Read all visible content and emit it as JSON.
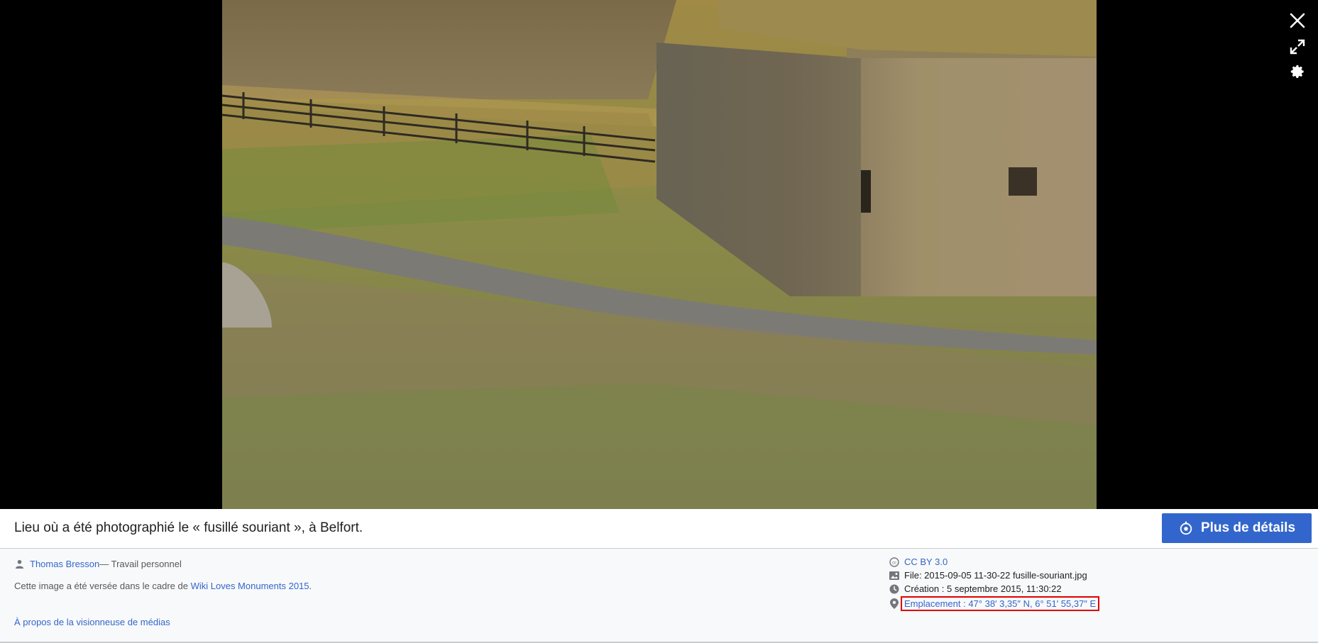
{
  "viewer": {
    "controls": {
      "close": "close-icon",
      "fullscreen": "fullscreen-icon",
      "settings": "gear-icon"
    }
  },
  "caption": {
    "title": "Lieu où a été photographié le « fusillé souriant », à Belfort.",
    "more_details_label": "Plus de détails"
  },
  "attribution": {
    "author": "Thomas Bresson",
    "author_suffix": " — Travail personnel",
    "contest_prefix": "Cette image a été versée dans le cadre de ",
    "contest_link": "Wiki Loves Monuments 2015",
    "contest_suffix": "."
  },
  "metadata": {
    "license": "CC BY 3.0",
    "file": "File: 2015-09-05 11-30-22 fusille-souriant.jpg",
    "creation": "Création : 5 septembre 2015, 11:30:22",
    "location": "Emplacement : 47° 38′ 3,35″ N, 6° 51′ 55,37″ E"
  },
  "footer": {
    "about_link": "À propos de la visionneuse de médias"
  },
  "colors": {
    "accent": "#3366cc",
    "highlight": "#e00000"
  }
}
